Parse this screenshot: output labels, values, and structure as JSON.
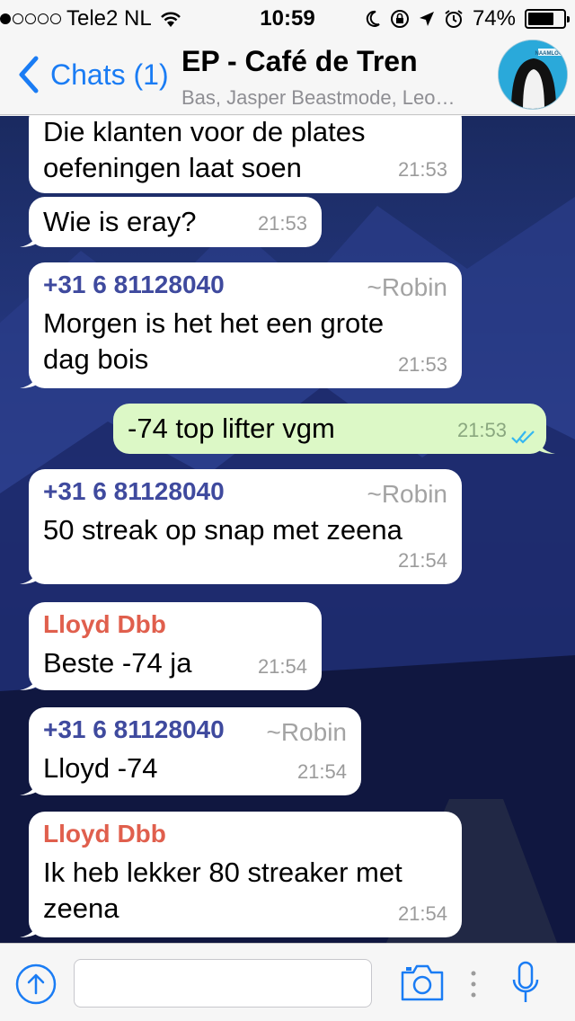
{
  "status_bar": {
    "carrier": "Tele2 NL",
    "time": "10:59",
    "battery": "74%",
    "battery_level": 0.74,
    "signal_bars_filled": 1,
    "signal_bars_total": 5
  },
  "header": {
    "back_label": "Chats (1)",
    "title": "EP - Café de Tren",
    "subtitle": "Bas, Jasper Beastmode, Leo…",
    "avatar_text": "NAAMLOOS"
  },
  "messages": [
    {
      "direction": "in",
      "sender": "",
      "alias": "",
      "text_lines": [
        "Die klanten voor de plates",
        "oefeningen laat soen"
      ],
      "time": "21:53"
    },
    {
      "direction": "in",
      "sender": "",
      "alias": "",
      "text_lines": [
        "Wie is eray?"
      ],
      "time": "21:53"
    },
    {
      "direction": "in",
      "sender": "+31 6 81128040",
      "alias": "~Robin",
      "text_lines": [
        "Morgen is het het een grote",
        "dag bois"
      ],
      "time": "21:53"
    },
    {
      "direction": "out",
      "sender": "",
      "alias": "",
      "text_lines": [
        "-74 top lifter vgm"
      ],
      "time": "21:53"
    },
    {
      "direction": "in",
      "sender": "+31 6 81128040",
      "alias": "~Robin",
      "text_lines": [
        "50 streak op snap met zeena"
      ],
      "time": "21:54"
    },
    {
      "direction": "in",
      "sender": "Lloyd Dbb",
      "alias": "",
      "text_lines": [
        "Beste -74 ja"
      ],
      "time": "21:54"
    },
    {
      "direction": "in",
      "sender": "+31 6 81128040",
      "alias": "~Robin",
      "text_lines": [
        "Lloyd -74"
      ],
      "time": "21:54"
    },
    {
      "direction": "in",
      "sender": "Lloyd Dbb",
      "alias": "",
      "text_lines": [
        "Ik heb lekker 80 streaker met",
        "zeena"
      ],
      "time": "21:54"
    }
  ],
  "input": {
    "value": "",
    "placeholder": ""
  },
  "icons": [
    "upload-icon",
    "camera-icon",
    "microphone-icon"
  ],
  "colors": {
    "accent": "#1a7cf4",
    "outgoing_bubble": "#dcf8c6",
    "incoming_bubble": "#ffffff",
    "sender_phone": "#3f4a9e",
    "sender_named": "#e05f4d",
    "read_ticks": "#34b7f1"
  }
}
